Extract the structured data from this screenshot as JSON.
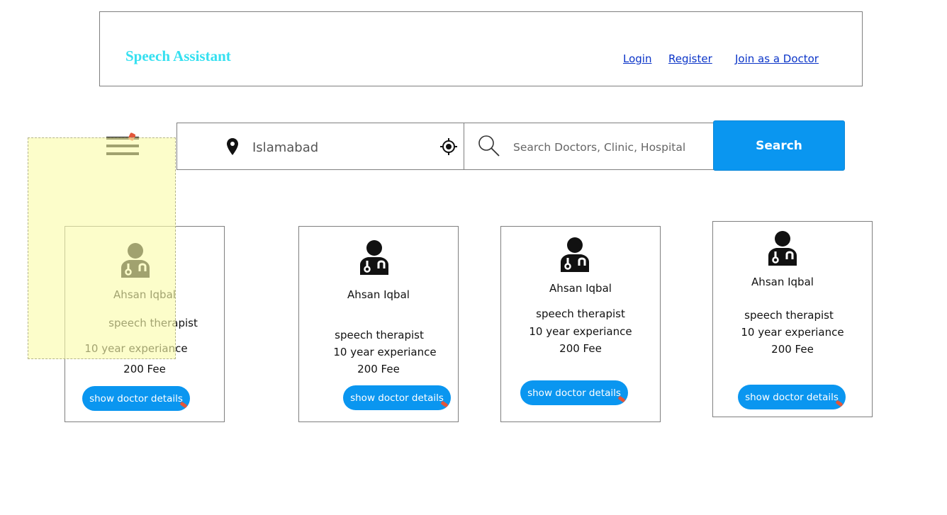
{
  "header": {
    "brand": "Speech Assistant",
    "links": {
      "login": "Login",
      "register": "Register",
      "join": "Join as a Doctor"
    }
  },
  "search": {
    "location": "Islamabad",
    "placeholder": "Search Doctors, Clinic, Hospital",
    "button_label": "Search"
  },
  "cards": [
    {
      "name": "Ahsan Iqbal",
      "specialty": "speech therapist",
      "experience": "10 year experiance",
      "fee": "200 Fee",
      "button": "show doctor details"
    },
    {
      "name": "Ahsan Iqbal",
      "specialty": "speech therapist",
      "experience": "10 year experiance",
      "fee": "200 Fee",
      "button": "show doctor details"
    },
    {
      "name": "Ahsan Iqbal",
      "specialty": "speech therapist",
      "experience": "10 year experiance",
      "fee": "200 Fee",
      "button": "show doctor details"
    },
    {
      "name": "Ahsan Iqbal",
      "specialty": "speech therapist",
      "experience": "10 year experiance",
      "fee": "200 Fee",
      "button": "show doctor details"
    }
  ],
  "colors": {
    "brand": "#35e0f0",
    "accent": "#0a96f0",
    "link": "#0a34c8",
    "note": "#fafcaa"
  },
  "icons": [
    "menu-icon",
    "map-pin-icon",
    "locate-icon",
    "search-icon",
    "doctor-icon"
  ]
}
